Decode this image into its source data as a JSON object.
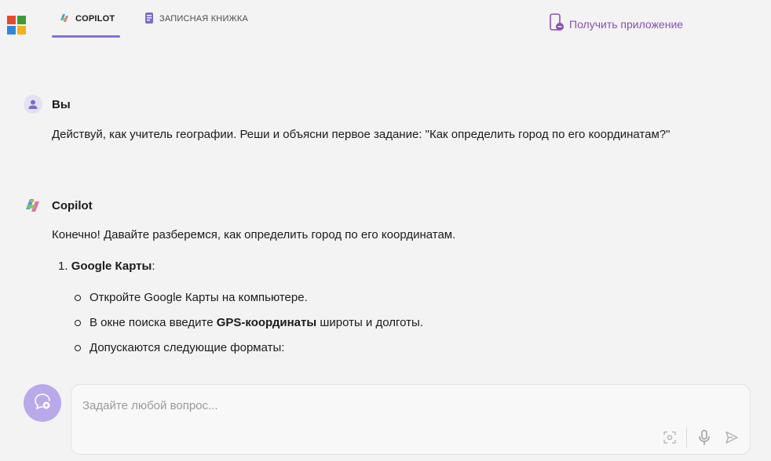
{
  "header": {
    "tabs": [
      {
        "label": "COPILOT",
        "active": true
      },
      {
        "label": "ЗАПИСНАЯ КНИЖКА",
        "active": false
      }
    ],
    "get_app_label": "Получить приложение"
  },
  "conversation": {
    "user": {
      "name": "Вы",
      "message": "Действуй, как учитель географии. Реши и объясни первое задание: \"Как определить город по его координатам?\""
    },
    "assistant": {
      "name": "Copilot",
      "intro": "Конечно! Давайте разберемся, как определить город по его координатам.",
      "list": [
        {
          "number": "1.",
          "title": "Google Карты",
          "suffix": ":",
          "bullets": [
            {
              "text": "Откройте Google Карты на компьютере."
            },
            {
              "before": "В окне поиска введите ",
              "bold": "GPS-координаты",
              "after": " широты и долготы."
            },
            {
              "text": "Допускаются следующие форматы:"
            }
          ]
        }
      ]
    }
  },
  "composer": {
    "placeholder": "Задайте любой вопрос..."
  },
  "colors": {
    "accent": "#8a6fd6",
    "link": "#8b4fb3",
    "background": "#f3f3f3",
    "new_chat_button": "#b9a9ea"
  },
  "icons": {
    "logo": "microsoft-logo",
    "copilot_tab": "copilot-icon",
    "notebook_tab": "notebook-icon",
    "get_app": "phone-icon",
    "user_avatar": "user-icon",
    "assistant_avatar": "copilot-icon",
    "new_chat": "new-chat-icon",
    "image_search": "image-search-icon",
    "microphone": "microphone-icon",
    "send": "send-icon"
  }
}
